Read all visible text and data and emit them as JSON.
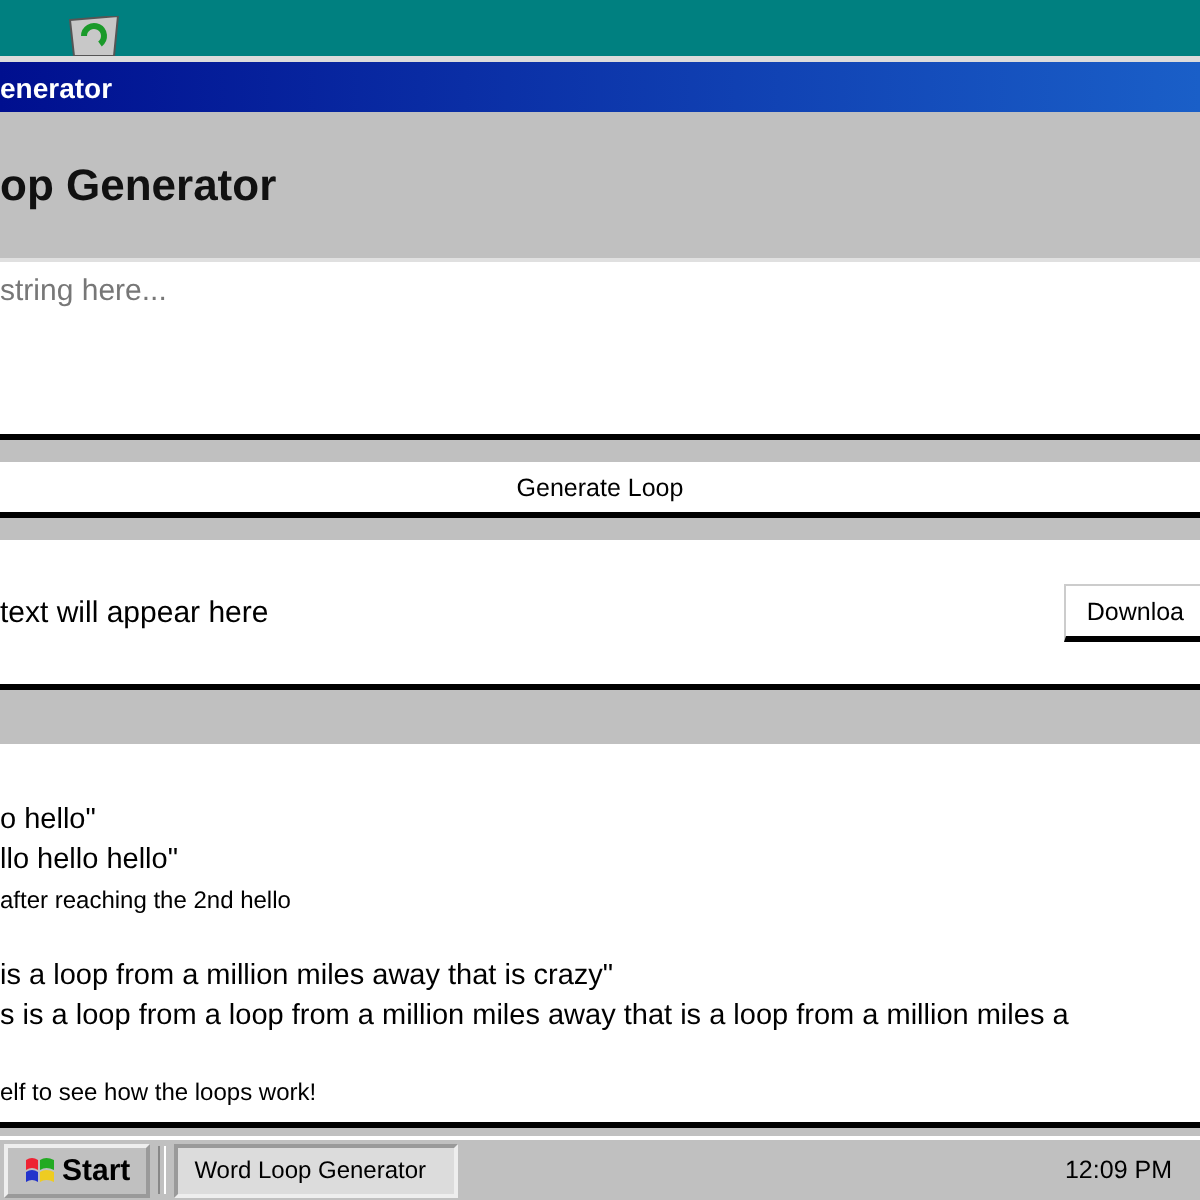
{
  "window": {
    "title": "enerator"
  },
  "app": {
    "heading": "op Generator",
    "input": {
      "placeholder": "string here..."
    },
    "generate_button": "Generate Loop",
    "output": {
      "placeholder": "text will appear here",
      "download_button": "Downloa"
    },
    "examples": [
      {
        "kind": "large",
        "text": "o hello\""
      },
      {
        "kind": "large",
        "text": "llo hello hello\""
      },
      {
        "kind": "small",
        "text": "after reaching the 2nd hello"
      },
      {
        "kind": "gap"
      },
      {
        "kind": "large",
        "text": "is a loop from a million miles away that is crazy\""
      },
      {
        "kind": "large",
        "text": "s is a loop from a loop from a million miles away that is a loop from a million miles a"
      },
      {
        "kind": "gap"
      },
      {
        "kind": "small",
        "text": "elf to see how the loops work!"
      }
    ]
  },
  "taskbar": {
    "start": "Start",
    "tasks": [
      {
        "label": "Word Loop Generator",
        "selected": true
      }
    ],
    "clock": "12:09 PM"
  }
}
